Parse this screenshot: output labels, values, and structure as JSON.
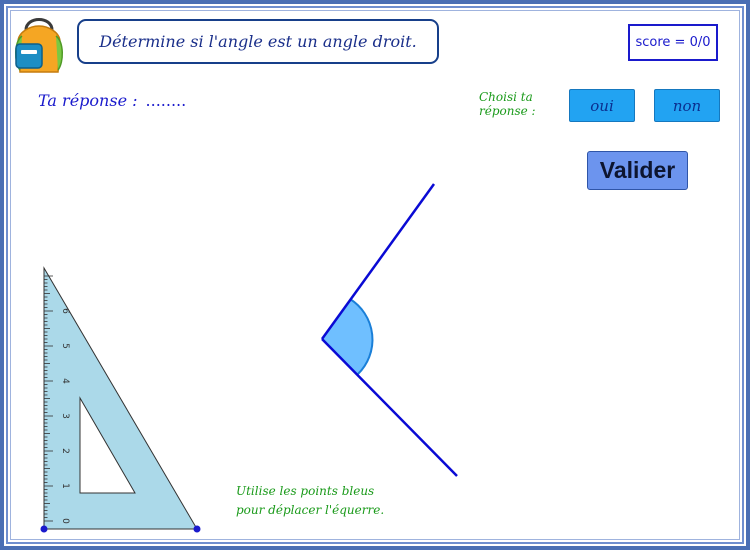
{
  "title": "Détermine si l'angle est un angle droit.",
  "score": {
    "label": "score = 0/0"
  },
  "answer": {
    "label": "Ta réponse :",
    "value": "........"
  },
  "choice": {
    "prompt_line1": "Choisi ta",
    "prompt_line2": "réponse :",
    "options": [
      "oui",
      "non"
    ]
  },
  "validate_label": "Valider",
  "hint": {
    "line1": "Utilise les points bleus",
    "line2": "pour déplacer l'équerre."
  },
  "set_square": {
    "scale_labels": [
      "0",
      "1",
      "2",
      "3",
      "4",
      "5",
      "6"
    ]
  },
  "colors": {
    "frame": "#4a6fb4",
    "title_text": "#1a2f8a",
    "accent_blue": "#1a1acc",
    "choice_button": "#22a3f2",
    "validate_button": "#6c94ee",
    "hint_green": "#1a9a1a",
    "angle_arms": "#0a0ad4",
    "angle_fill": "#6fbfff",
    "set_square_fill": "#abd9e9"
  }
}
